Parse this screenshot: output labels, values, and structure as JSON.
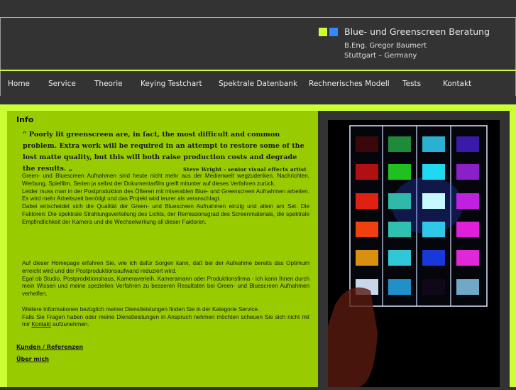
{
  "header": {
    "brand_colors": [
      "#ccff33",
      "#3388ff"
    ],
    "title": "Blue- und Greenscreen Beratung",
    "name": "B.Eng. Gregor Baumert",
    "location": "Stuttgart – Germany"
  },
  "nav": {
    "items": [
      {
        "label": "Home"
      },
      {
        "label": "Service"
      },
      {
        "label": "Theorie"
      },
      {
        "label": "Keying Testchart"
      },
      {
        "label": "Spektrale Datenbank"
      },
      {
        "label": "Rechnerisches Modell"
      },
      {
        "label": "Tests"
      },
      {
        "label": "Kontakt"
      }
    ]
  },
  "main": {
    "heading": "Info",
    "quote": "“ Poorly lit greenscreen are, in fact, the most difficult and common problem. Extra work will be required in an attempt to restore some of the lost matte quality, but this will both raise production costs and degrade the results. „",
    "quote_author": "Steve Wright - senior visual effects artist",
    "paragraph1": "Green- und Bluescreen Aufnahmen sind heute nicht mehr aus der Medienwelt wegzudenken. Nachrichten, Werbung, Spielfilm, Serien ja selbst der Dokumentarfilm greift mitunter auf dieses Verfahren zurück.",
    "paragraph2": "Leider muss man in der Postproduktion des Öfteren mit miserablen Blue- und Greenscreen Aufnahmen arbeiten. Es wird mehr Arbeitszeit benötigt und das Projekt wird teurer als veranschlagt.",
    "paragraph3": "Dabei entscheidet sich die Qualität der Green- und Bluescreen Aufnahmen einzig und allein am Set. Die Faktoren: Die spektrale Strahlungsverteilung des Lichts, der Remissionsgrad des Screenmaterials, die spektrale Empfindlichkeit der Kamera und die Wechselwirkung all dieser Faktoren.",
    "paragraph4": "Auf dieser Homepage erfahren Sie, wie ich dafür Sorgen kann, daß bei der Aufnahme bereits das Optimum erreicht wird und der Postproduktionsaufwand reduziert wird.",
    "paragraph5": "Egal ob Studio, Postprodktionshaus, Kameraverleih, Kameramann oder Produktionsfirma - ich kann Ihnen durch mein Wissen und meine speziellen Verfahren zu besseren Resultaten bei Green- und Bluescreen Aufnahmen verhelfen.",
    "paragraph6": "Weitere Informationen bezüglich meiner Dienstleistungen finden Sie in der Kategorie Service.",
    "paragraph7_before": "Falls Sie Fragen haben oder meine Dienstleistungen in Anspruch nehmen möchten scheuen Sie sich nicht mit mir ",
    "paragraph7_link": "Kontakt",
    "paragraph7_after": " aufzunehmen.",
    "link_references": "Kunden / Referenzen",
    "link_about": "Über mich"
  },
  "photo": {
    "patch_colors": [
      [
        "#3a0808",
        "#1e8a3a",
        "#2ab0d0",
        "#3a1aa8"
      ],
      [
        "#b01010",
        "#20c020",
        "#20d8f0",
        "#8a20c8"
      ],
      [
        "#e02010",
        "#30b8a8",
        "#c8f8ff",
        "#c020e0"
      ],
      [
        "#f04010",
        "#30c0b0",
        "#30c8e8",
        "#e020d8"
      ],
      [
        "#d89010",
        "#30c8d8",
        "#1838d8",
        "#e028d8"
      ],
      [
        "#c8d8e8",
        "#2090c8",
        "#100818",
        "#70a8c8"
      ]
    ]
  }
}
